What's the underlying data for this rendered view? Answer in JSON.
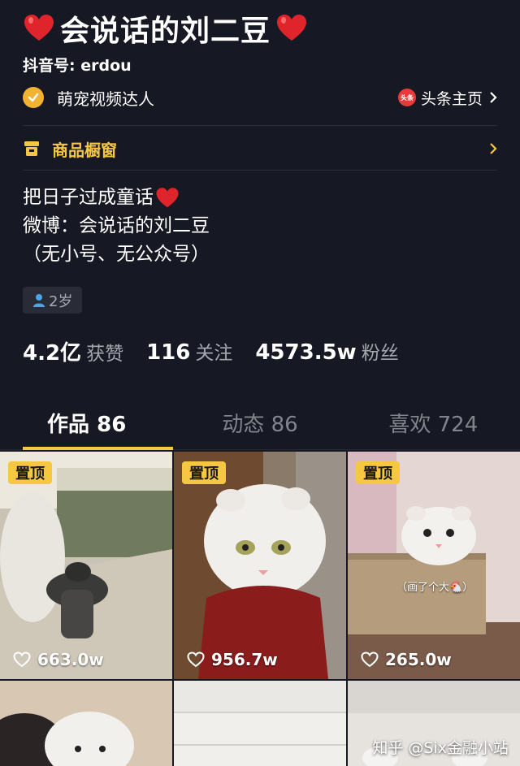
{
  "profile": {
    "name": "会说话的刘二豆",
    "douyin_id": "抖音号: erdou",
    "verification": "萌宠视频达人",
    "toutiao_badge": "头条",
    "toutiao_link": "头条主页",
    "shop_label": "商品橱窗",
    "bio": [
      "把日子过成童话",
      "微博：会说话的刘二豆",
      "（无小号、无公众号）"
    ],
    "age": "2岁"
  },
  "stats": [
    {
      "value": "4.2亿",
      "label": "获赞"
    },
    {
      "value": "116",
      "label": "关注"
    },
    {
      "value": "4573.5w",
      "label": "粉丝"
    }
  ],
  "tabs": [
    {
      "label": "作品 86",
      "active": true
    },
    {
      "label": "动态 86",
      "active": false
    },
    {
      "label": "喜欢 724",
      "active": false
    }
  ],
  "videos": [
    {
      "pinned": "置顶",
      "likes": "663.0w"
    },
    {
      "pinned": "置顶",
      "likes": "956.7w"
    },
    {
      "pinned": "置顶",
      "likes": "265.0w",
      "caption": "（画了个大🐔）"
    }
  ],
  "watermark": "知乎 @Six金融小站",
  "colors": {
    "background": "#161823",
    "accent": "#f6c741",
    "verify": "#f2b232"
  }
}
